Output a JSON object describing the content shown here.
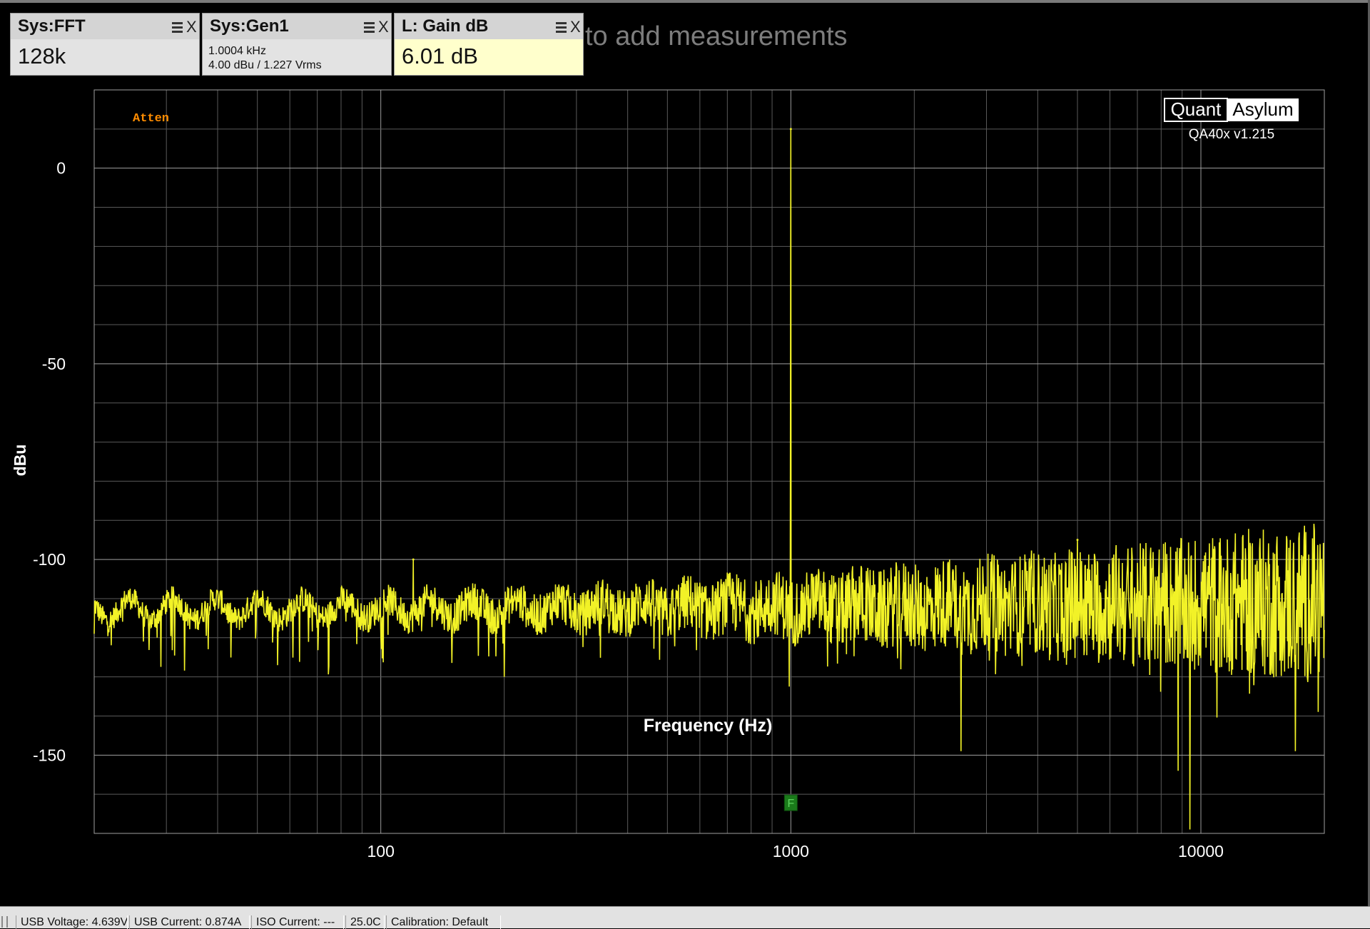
{
  "measurement_widgets": [
    {
      "title": "Sys:FFT",
      "value": "128k"
    },
    {
      "title": "Sys:Gen1",
      "line1": "1.0004 kHz",
      "line2": "4.00 dBu  / 1.227 Vrms"
    },
    {
      "title": "L: Gain dB",
      "value": "6.01 dB"
    }
  ],
  "widget_close_glyph": "X",
  "menu_icon": "hamburger-menu-icon",
  "add_hint": "to add measurements",
  "chart_data": {
    "type": "line",
    "xlabel": "Frequency (Hz)",
    "ylabel": "dBu",
    "xscale": "log",
    "xlim": [
      20,
      20000
    ],
    "ylim": [
      -170,
      20
    ],
    "xticks": [
      100,
      1000,
      10000
    ],
    "xtick_labels": [
      "100",
      "1000",
      "10000"
    ],
    "yticks": [
      0,
      -50,
      -100,
      -150
    ],
    "ytick_labels": [
      "0",
      "-50",
      "-100",
      "-150"
    ],
    "grid": true,
    "series": [
      {
        "color": "#f2f227",
        "peaks": [
          {
            "x": 1000,
            "y": 10
          },
          {
            "x": 5000,
            "y": -95
          },
          {
            "x": 120,
            "y": -100
          }
        ],
        "dips": [
          {
            "x": 56,
            "y": -127
          },
          {
            "x": 200,
            "y": -130
          },
          {
            "x": 2600,
            "y": -149
          },
          {
            "x": 8800,
            "y": -154
          },
          {
            "x": 9400,
            "y": -169
          },
          {
            "x": 17000,
            "y": -149
          }
        ],
        "noise_floor_start": -119,
        "noise_floor_end": -118
      }
    ],
    "annotation_label": "Atten",
    "marker": {
      "x": 1000,
      "label": "F"
    }
  },
  "logo": {
    "left": "Quant",
    "right": "Asylum",
    "version": "QA40x v1.215"
  },
  "status_bar": [
    "USB Voltage: 4.639V",
    "USB Current: 0.874A",
    "ISO Current: ---",
    "25.0C",
    "Calibration: Default"
  ],
  "colors": {
    "trace": "#f2f227",
    "atten": "#ff8c00",
    "marker": "#1a7a1a",
    "background": "#000000"
  }
}
